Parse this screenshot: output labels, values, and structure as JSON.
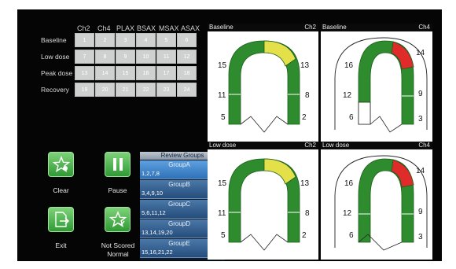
{
  "grid": {
    "columns": [
      "Ch2",
      "Ch4",
      "PLAX",
      "BSAX",
      "MSAX",
      "ASAX"
    ],
    "rows": [
      {
        "label": "Baseline",
        "cells": [
          "1",
          "2",
          "3",
          "4",
          "5",
          "6"
        ]
      },
      {
        "label": "Low dose",
        "cells": [
          "7",
          "8",
          "9",
          "10",
          "11",
          "12"
        ]
      },
      {
        "label": "Peak dose",
        "cells": [
          "13",
          "14",
          "15",
          "16",
          "17",
          "18"
        ]
      },
      {
        "label": "Recovery",
        "cells": [
          "19",
          "20",
          "21",
          "22",
          "23",
          "24"
        ]
      }
    ]
  },
  "buttons": {
    "clear": "Clear",
    "pause": "Pause",
    "exit": "Exit",
    "not_scored_line1": "Not Scored",
    "not_scored_line2": "Normal"
  },
  "review_groups": {
    "title": "Review Groups",
    "groups": [
      {
        "name": "GroupA",
        "value": "1,2,7,8"
      },
      {
        "name": "GroupB",
        "value": "3,4,9,10"
      },
      {
        "name": "GroupC",
        "value": "5,6,11,12"
      },
      {
        "name": "GroupD",
        "value": "13,14,19,20"
      },
      {
        "name": "GroupE",
        "value": "15,16,21,22"
      }
    ]
  },
  "panels": [
    {
      "title": "Baseline",
      "channel": "Ch2",
      "labels": [
        "15",
        "13",
        "11",
        "8",
        "5",
        "2"
      ]
    },
    {
      "title": "Baseline",
      "channel": "Ch4",
      "labels": [
        "16",
        "14",
        "12",
        "9",
        "6",
        "3"
      ]
    },
    {
      "title": "Low dose",
      "channel": "Ch2",
      "labels": [
        "15",
        "13",
        "11",
        "8",
        "5",
        "2"
      ]
    },
    {
      "title": "Low dose",
      "channel": "Ch4",
      "labels": [
        "16",
        "14",
        "12",
        "9",
        "6",
        "3"
      ]
    }
  ],
  "colors": {
    "normal": "#2e8b2e",
    "hypokinetic": "#e3e04a",
    "akinetic": "#e02b2b",
    "selected_group": "#3a85cc"
  }
}
